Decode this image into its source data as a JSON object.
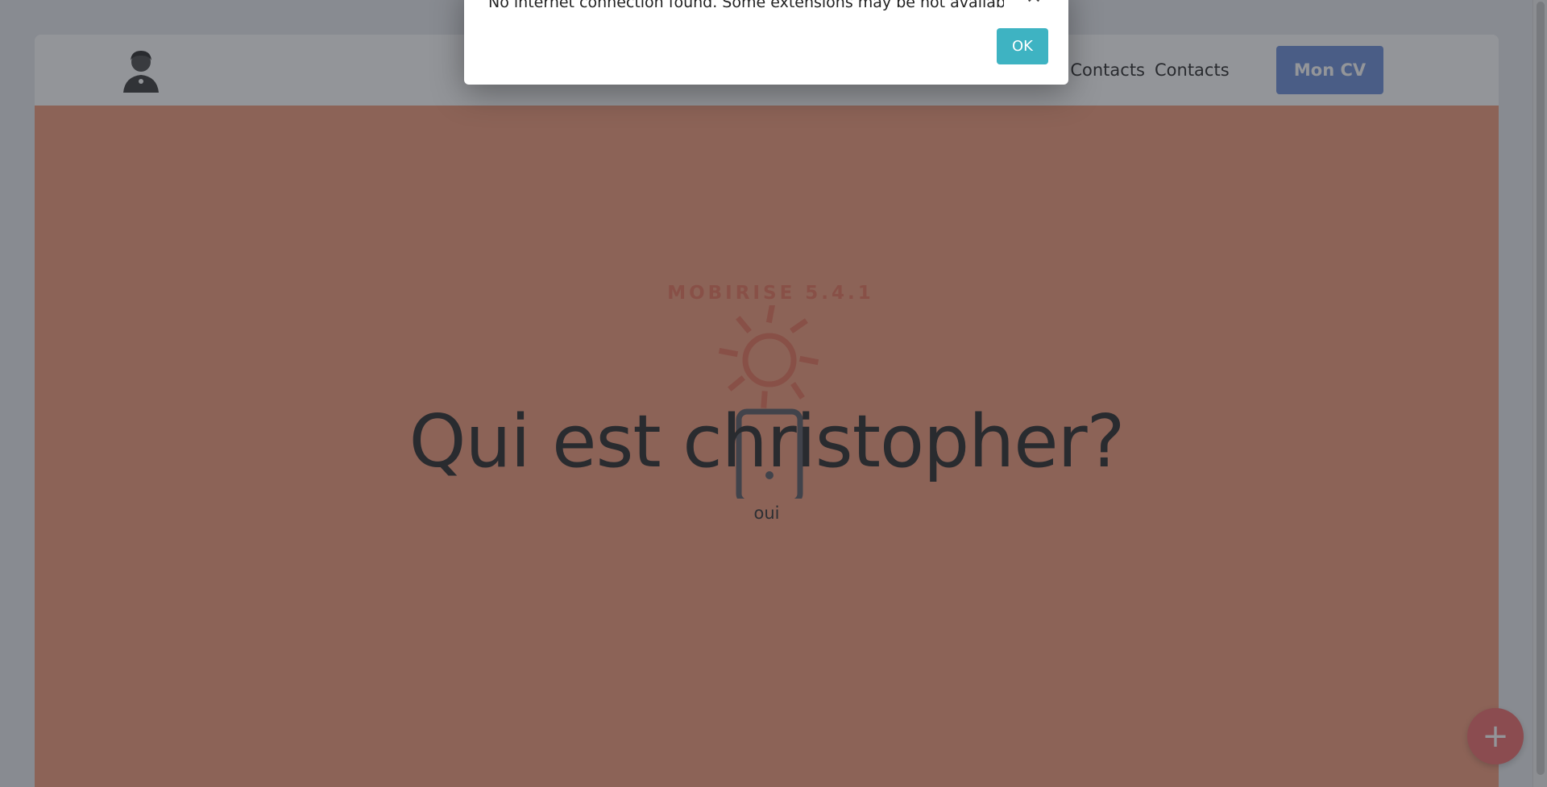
{
  "dialog": {
    "message": "No internet connection found. Some extensions may be not available.",
    "close_icon": "close-icon",
    "ok_label": "OK"
  },
  "site": {
    "nav": {
      "logo_icon": "person-avatar-logo",
      "links": [
        "Contacts",
        "Contacts"
      ],
      "cta_label": "Mon CV"
    },
    "hero": {
      "watermark": "MOBIRISE 5.4.1",
      "illustration_icon": "sun-and-phone-icon",
      "title": "Qui est christopher?",
      "subtitle": "oui"
    },
    "fab_icon": "plus-icon"
  },
  "colors": {
    "hero_background": "#f09a7a",
    "cta_background": "#6d8fd9",
    "ok_button": "#3eb3c2",
    "fab_background": "#ef6d6d",
    "overlay": "rgba(40,44,52,0.5)"
  }
}
